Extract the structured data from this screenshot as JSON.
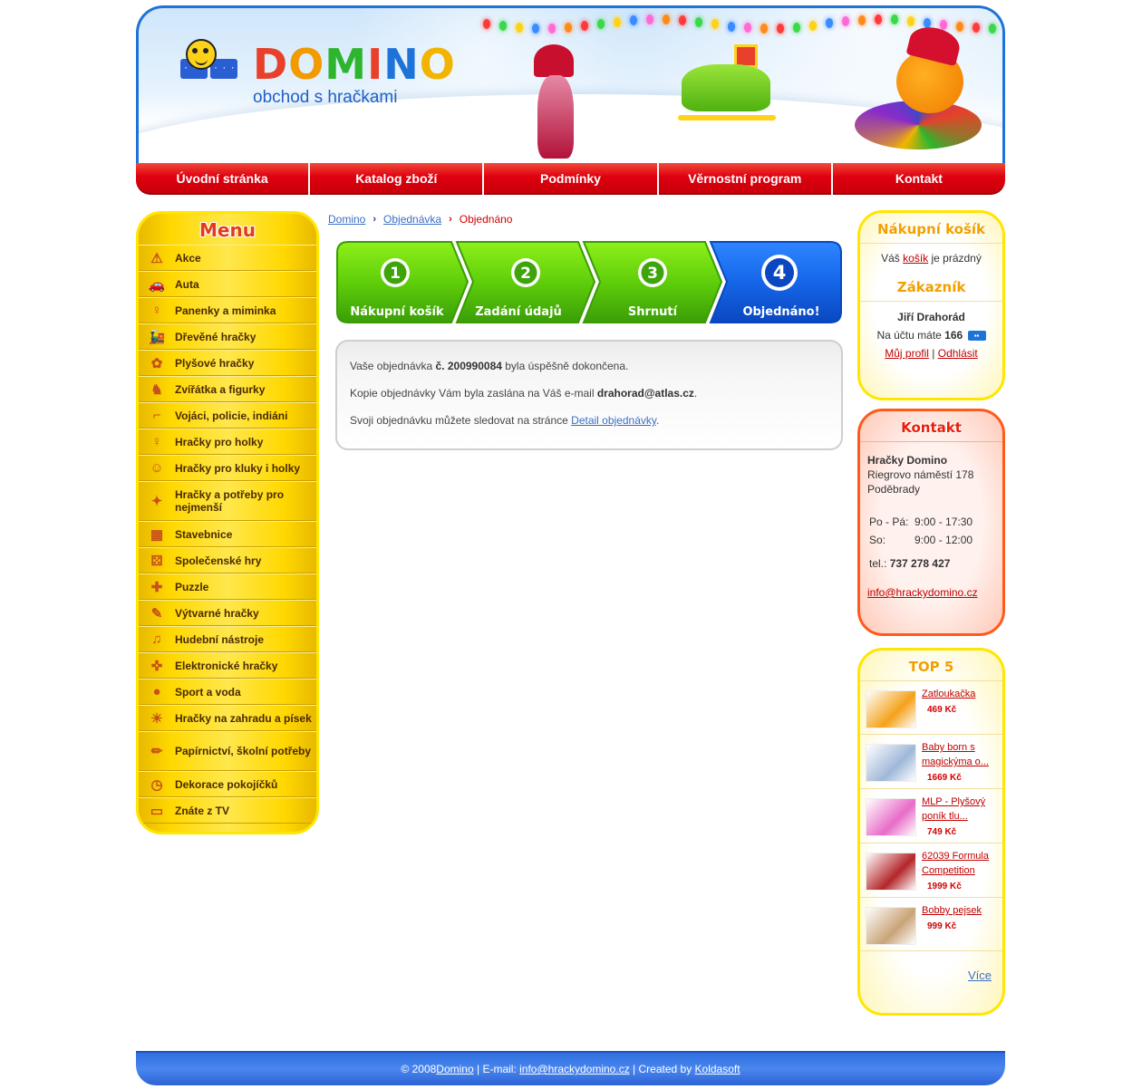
{
  "header": {
    "brand": "DOMINO",
    "tagline": "obchod s hračkami"
  },
  "nav": [
    "Úvodní stránka",
    "Katalog zboží",
    "Podmínky",
    "Věrnostní program",
    "Kontakt"
  ],
  "menu": {
    "title": "Menu",
    "items": [
      {
        "label": "Akce",
        "icon": "warning-icon"
      },
      {
        "label": "Auta",
        "icon": "car-icon"
      },
      {
        "label": "Panenky a miminka",
        "icon": "rattle-icon"
      },
      {
        "label": "Dřevěné hračky",
        "icon": "train-icon"
      },
      {
        "label": "Plyšové hračky",
        "icon": "teddy-icon"
      },
      {
        "label": "Zvířátka a figurky",
        "icon": "elephant-icon"
      },
      {
        "label": "Vojáci, policie, indiáni",
        "icon": "gun-icon"
      },
      {
        "label": "Hračky pro holky",
        "icon": "girl-icon"
      },
      {
        "label": "Hračky pro kluky i holky",
        "icon": "kids-icon"
      },
      {
        "label": "Hračky a potřeby pro nejmenší",
        "icon": "pacifier-icon"
      },
      {
        "label": "Stavebnice",
        "icon": "blocks-icon"
      },
      {
        "label": "Společenské hry",
        "icon": "dice-icon"
      },
      {
        "label": "Puzzle",
        "icon": "puzzle-icon"
      },
      {
        "label": "Výtvarné hračky",
        "icon": "palette-icon"
      },
      {
        "label": "Hudební nástroje",
        "icon": "music-icon"
      },
      {
        "label": "Elektronické hračky",
        "icon": "gamepad-icon"
      },
      {
        "label": "Sport a voda",
        "icon": "ball-icon"
      },
      {
        "label": "Hračky na zahradu a písek",
        "icon": "bucket-icon"
      },
      {
        "label": "Papírnictví, školní potřeby",
        "icon": "pencil-icon"
      },
      {
        "label": "Dekorace pokojíčků",
        "icon": "clock-icon"
      },
      {
        "label": "Znáte z TV",
        "icon": "tv-icon"
      }
    ]
  },
  "breadcrumb": {
    "home": "Domino",
    "order": "Objednávka",
    "current": "Objednáno"
  },
  "steps": [
    {
      "num": "1",
      "label": "Nákupní košík"
    },
    {
      "num": "2",
      "label": "Zadání údajů"
    },
    {
      "num": "3",
      "label": "Shrnutí"
    },
    {
      "num": "4",
      "label": "Objednáno!"
    }
  ],
  "message": {
    "l1_pre": "Vaše objednávka ",
    "l1_bold": "č. 200990084",
    "l1_post": " byla úspěšně dokončena.",
    "l2_pre": "Kopie objednávky Vám byla zaslána na Váš e-mail ",
    "l2_bold": "drahorad@atlas.cz",
    "l2_post": ".",
    "l3_pre": "Svoji objednávku můžete sledovat na stránce ",
    "l3_link": "Detail objednávky",
    "l3_post": "."
  },
  "cart": {
    "title": "Nákupní košík",
    "pre": "Váš ",
    "link": "košík",
    "post": " je prázdný"
  },
  "customer": {
    "title": "Zákazník",
    "name": "Jiří Drahorád",
    "points_pre": "Na účtu máte ",
    "points": "166",
    "profile": "Můj profil",
    "sep": "|",
    "logout": "Odhlásit"
  },
  "contact": {
    "title": "Kontakt",
    "company": "Hračky Domino",
    "street": "Riegrovo náměstí 178",
    "city": "Poděbrady",
    "hours": [
      {
        "day": "Po - Pá:",
        "time": "9:00 - 17:30"
      },
      {
        "day": "So:",
        "time": "9:00 - 12:00"
      }
    ],
    "tel_label": "tel.:",
    "tel": "737 278 427",
    "email": "info@hrackydomino.cz"
  },
  "top5": {
    "title": "TOP 5",
    "items": [
      {
        "name": "Zatloukačka",
        "price": "469 Kč",
        "thumb": "#f4a21a"
      },
      {
        "name": "Baby born s magickýma o...",
        "price": "1669 Kč",
        "thumb": "#9fb8d8"
      },
      {
        "name": "MLP - Plyšový poník tlu...",
        "price": "749 Kč",
        "thumb": "#e86cc8"
      },
      {
        "name": "62039 Formula Competition",
        "price": "1999 Kč",
        "thumb": "#b3262a"
      },
      {
        "name": "Bobby pejsek",
        "price": "999 Kč",
        "thumb": "#c9a478"
      }
    ],
    "more": "Více"
  },
  "footer": {
    "pre": "© 2008 ",
    "brand": "Domino",
    "mid": " | E-mail: ",
    "email": "info@hrackydomino.cz",
    "mid2": " | Created by ",
    "creator": "Koldasoft"
  }
}
